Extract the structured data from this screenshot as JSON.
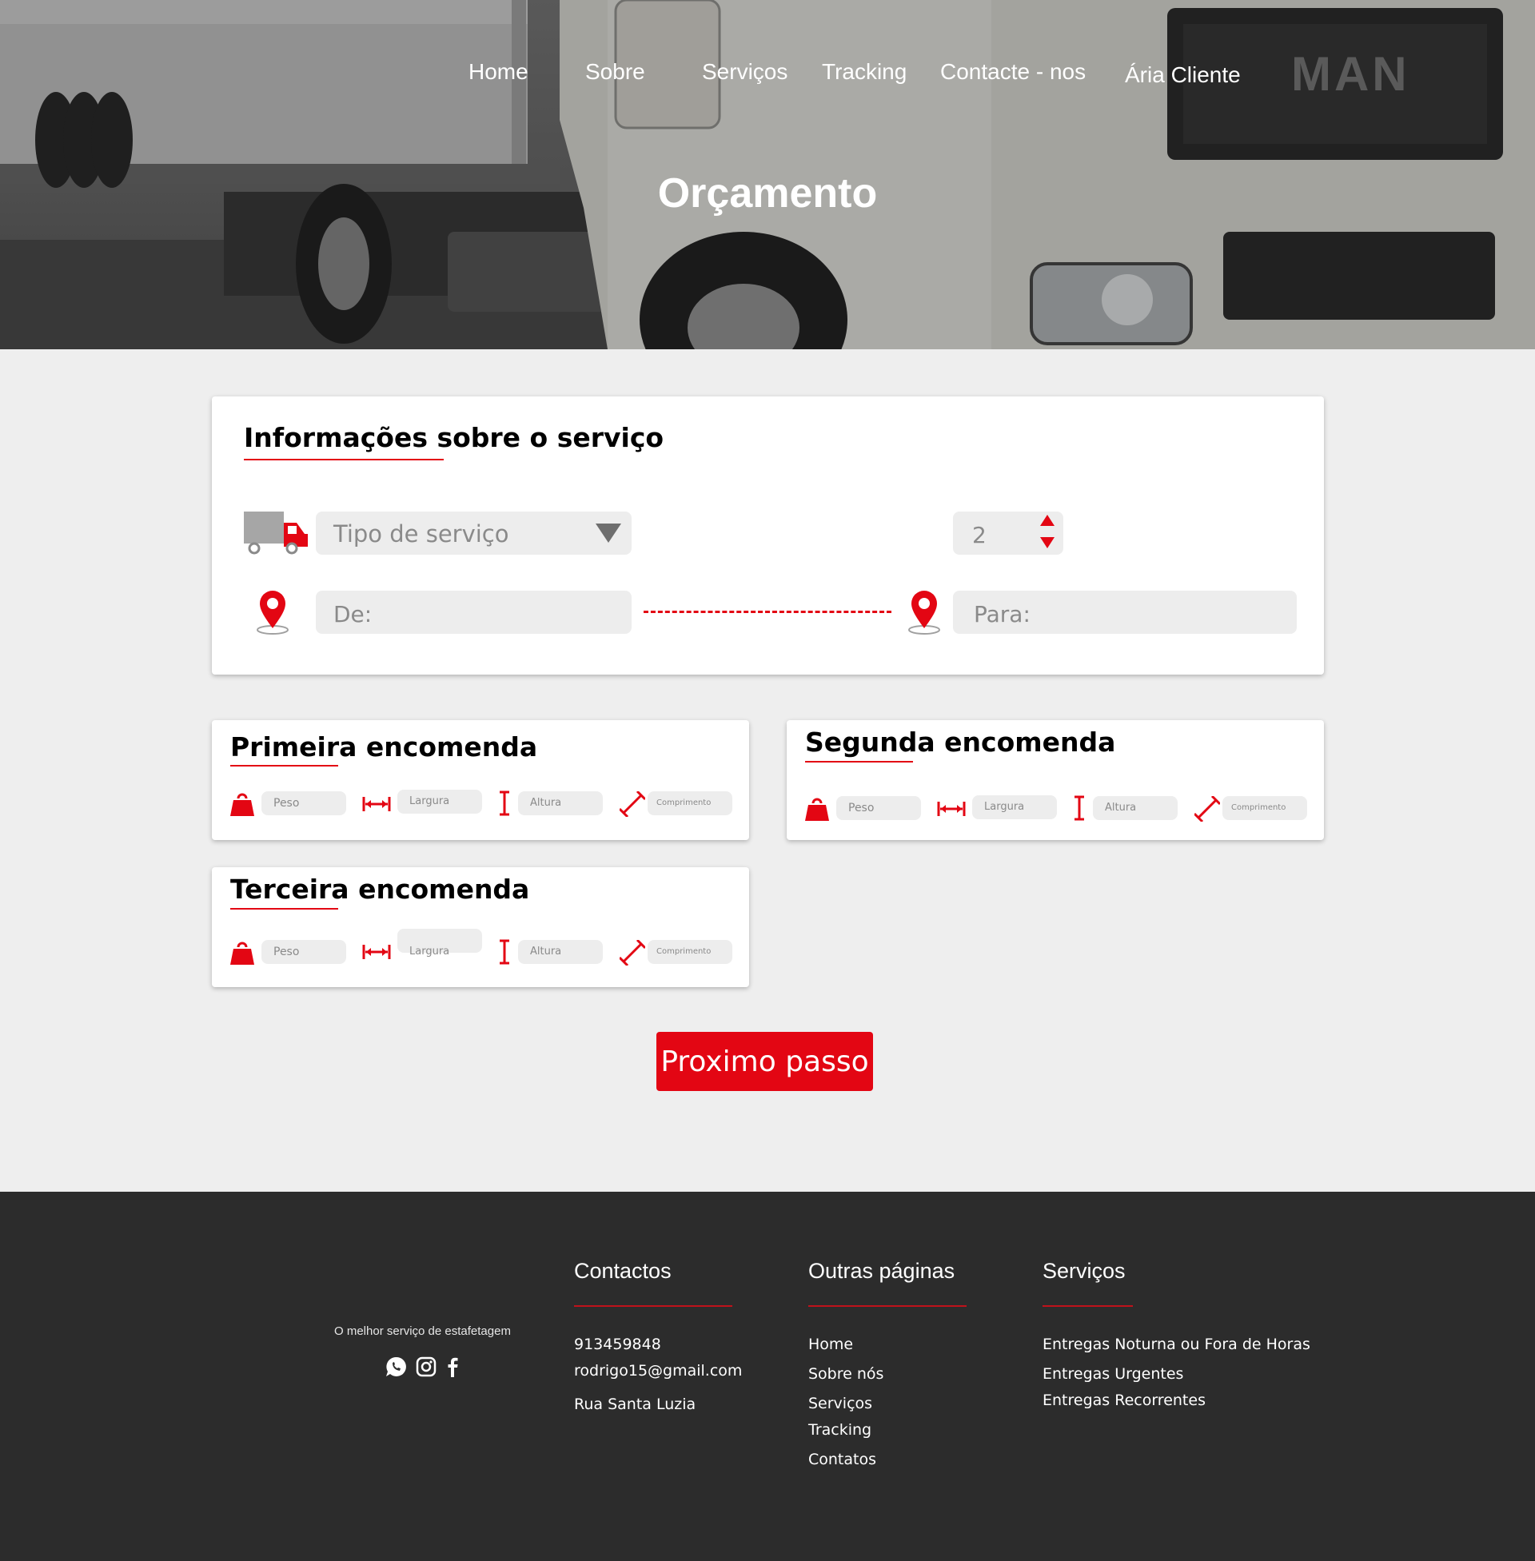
{
  "nav": {
    "items": [
      "Home",
      "Sobre",
      "Serviços",
      "Tracking",
      "Contacte - nos",
      "Ária Cliente"
    ]
  },
  "hero": {
    "title": "Orçamento",
    "brand_plate": "MAN"
  },
  "service_card": {
    "title": "Informações sobre o serviço",
    "service_type_placeholder": "Tipo de serviço",
    "quantity_value": "2",
    "from_placeholder": "De:",
    "to_placeholder": "Para:",
    "icons": [
      "truck-icon",
      "location-pin-icon",
      "chevron-down-icon",
      "spin-up-icon",
      "spin-down-icon"
    ]
  },
  "orders": [
    {
      "title": "Primeira encomenda",
      "weight": "Peso",
      "width": "Largura",
      "height": "Altura",
      "length": "Comprimento"
    },
    {
      "title": "Segunda encomenda",
      "weight": "Peso",
      "width": "Largura",
      "height": "Altura",
      "length": "Comprimento"
    },
    {
      "title": "Terceira encomenda",
      "weight": "Peso",
      "width": "Largura",
      "height": "Altura",
      "length": "Comprimento"
    }
  ],
  "next_button": "Proximo passo",
  "footer": {
    "tagline": "O melhor serviço de estafetagem",
    "social": [
      "whatsapp-icon",
      "instagram-icon",
      "facebook-icon"
    ],
    "contacts": {
      "title": "Contactos",
      "items": [
        "913459848",
        "rodrigo15@gmail.com",
        "Rua Santa Luzia"
      ]
    },
    "pages": {
      "title": "Outras páginas",
      "items": [
        "Home",
        "Sobre nós",
        "Serviços",
        "Tracking",
        "Contatos"
      ]
    },
    "services": {
      "title": "Serviços",
      "items": [
        "Entregas Noturna ou Fora de Horas",
        "Entregas Urgentes",
        "Entregas Recorrentes"
      ]
    }
  },
  "colors": {
    "accent": "#e30613",
    "footer_bg": "#2c2c2c",
    "page_bg": "#eeeeee",
    "field_bg": "#ededed"
  }
}
